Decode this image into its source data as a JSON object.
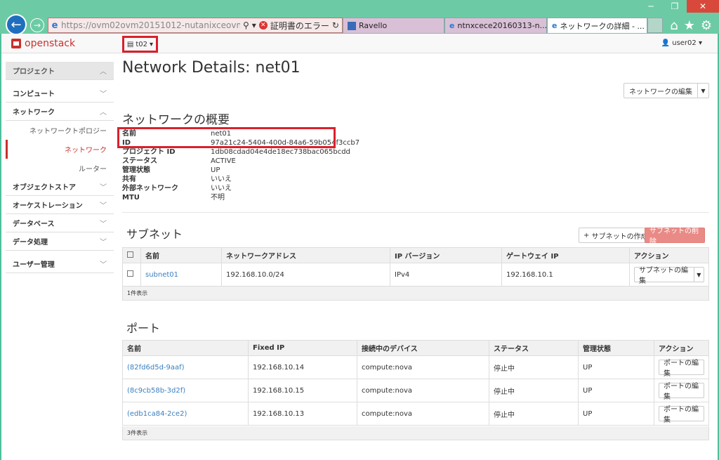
{
  "browser": {
    "url": "https://ovm02ovm20151012-nutanixceovmde...",
    "cert_error": "証明書のエラー",
    "tabs": [
      {
        "label": "Ravello"
      },
      {
        "label": "ntnxcece20160313-n..."
      },
      {
        "label": "ネットワークの詳細 - ..."
      }
    ]
  },
  "topbar": {
    "logo": "openstack",
    "project": "t02",
    "user": "user02"
  },
  "sidebar": {
    "project": "プロジェクト",
    "compute": "コンピュート",
    "network": "ネットワーク",
    "topology": "ネットワークトポロジー",
    "networks": "ネットワーク",
    "routers": "ルーター",
    "object_store": "オブジェクトストア",
    "orchestration": "オーケストレーション",
    "database": "データベース",
    "data_processing": "データ処理",
    "user_mgmt": "ユーザー管理"
  },
  "main": {
    "title": "Network Details: net01",
    "edit_network": "ネットワークの編集",
    "overview_title": "ネットワークの概要",
    "overview": [
      {
        "k": "名前",
        "v": "net01"
      },
      {
        "k": "ID",
        "v": "97a21c24-5404-400d-84a6-59b054f3ccb7"
      },
      {
        "k": "プロジェクト ID",
        "v": "1db08cdad04e4de18ec738bac065bcdd"
      },
      {
        "k": "ステータス",
        "v": "ACTIVE"
      },
      {
        "k": "管理状態",
        "v": "UP"
      },
      {
        "k": "共有",
        "v": "いいえ"
      },
      {
        "k": "外部ネットワーク",
        "v": "いいえ"
      },
      {
        "k": "MTU",
        "v": "不明"
      }
    ]
  },
  "subnets": {
    "title": "サブネット",
    "create": "サブネットの作成",
    "delete": "サブネットの削除",
    "headers": [
      "名前",
      "ネットワークアドレス",
      "IP バージョン",
      "ゲートウェイ IP",
      "アクション"
    ],
    "rows": [
      {
        "name": "subnet01",
        "cidr": "192.168.10.0/24",
        "ipver": "IPv4",
        "gw": "192.168.10.1",
        "action": "サブネットの編集"
      }
    ],
    "footer": "1件表示"
  },
  "ports": {
    "title": "ポート",
    "headers": [
      "名前",
      "Fixed IP",
      "接続中のデバイス",
      "ステータス",
      "管理状態",
      "アクション"
    ],
    "rows": [
      {
        "name": "(82fd6d5d-9aaf)",
        "ip": "192.168.10.14",
        "device": "compute:nova",
        "status": "停止中",
        "admin": "UP",
        "action": "ポートの編集"
      },
      {
        "name": "(8c9cb58b-3d2f)",
        "ip": "192.168.10.15",
        "device": "compute:nova",
        "status": "停止中",
        "admin": "UP",
        "action": "ポートの編集"
      },
      {
        "name": "(edb1ca84-2ce2)",
        "ip": "192.168.10.13",
        "device": "compute:nova",
        "status": "停止中",
        "admin": "UP",
        "action": "ポートの編集"
      }
    ],
    "footer": "3件表示"
  }
}
